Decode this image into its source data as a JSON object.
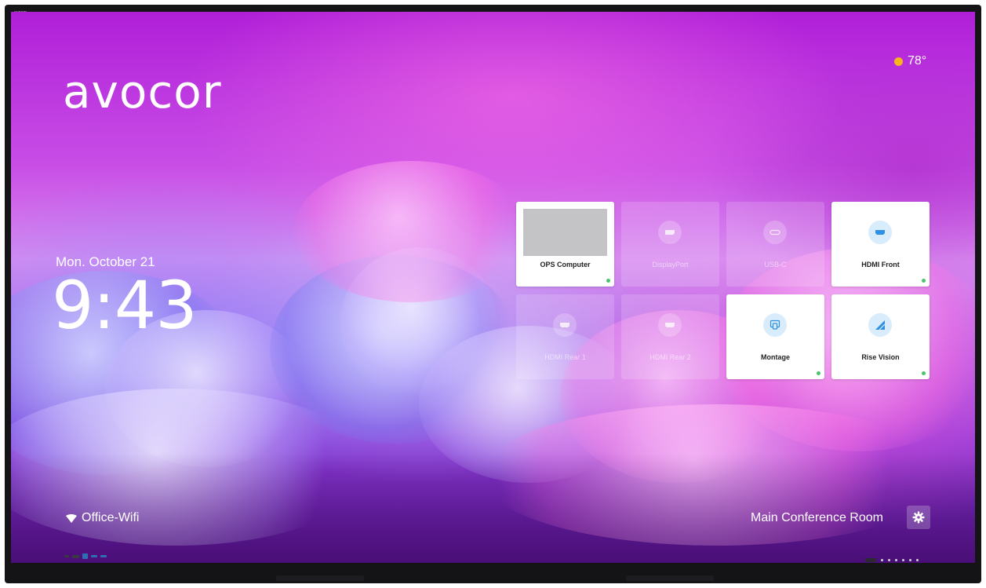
{
  "bezel": {
    "brand": "avocor"
  },
  "home": {
    "logo": "avocor",
    "weather": {
      "temperature": "78°",
      "icon": "sun-dot-icon",
      "icon_color": "#f6b51e"
    },
    "date": "Mon. October 21",
    "time": "9:43"
  },
  "sources": [
    {
      "label": "OPS Computer",
      "state": "active",
      "has_preview": true,
      "connected": true
    },
    {
      "label": "DisplayPort",
      "state": "inactive",
      "icon": "displayport-icon",
      "connected": false
    },
    {
      "label": "USB-C",
      "state": "inactive",
      "icon": "usb-c-icon",
      "connected": false
    },
    {
      "label": "HDMI Front",
      "state": "active",
      "icon": "hdmi-icon",
      "connected": true
    },
    {
      "label": "HDMI Rear 1",
      "state": "inactive",
      "icon": "hdmi-icon",
      "connected": false
    },
    {
      "label": "HDMI Rear 2",
      "state": "inactive",
      "icon": "hdmi-icon",
      "connected": false
    },
    {
      "label": "Montage",
      "state": "active",
      "icon": "montage-icon",
      "connected": true
    },
    {
      "label": "Rise Vision",
      "state": "active",
      "icon": "rise-vision-icon",
      "connected": true
    }
  ],
  "footer": {
    "wifi_name": "Office-Wifi",
    "wifi_icon": "wifi-icon",
    "room_name": "Main Conference Room",
    "settings_icon": "gear-icon"
  },
  "colors": {
    "accent_icon_bg": "#d9ecfb",
    "icon_blue": "#2f8fe0",
    "status_connected": "#4cc36b"
  }
}
